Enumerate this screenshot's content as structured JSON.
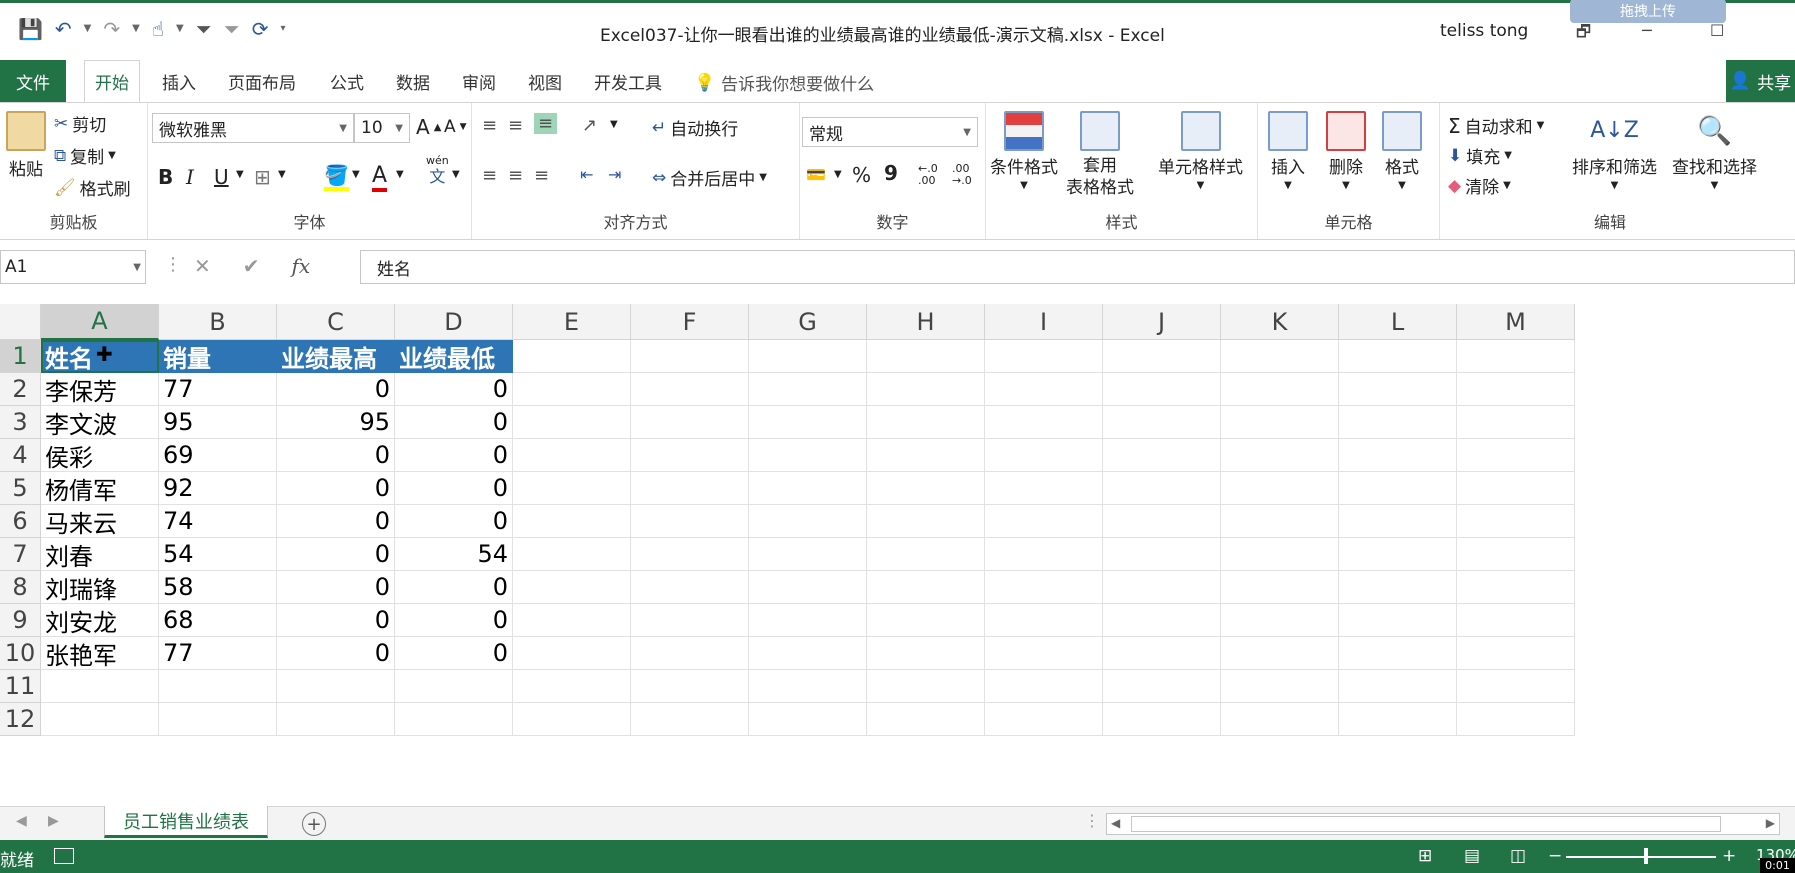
{
  "titlebar": {
    "doc_title": "Excel037-让你一眼看出谁的业绩最高谁的业绩最低-演示文稿.xlsx  -  Excel",
    "user": "teliss tong",
    "upload_label": "拖拽上传",
    "window_buttons": [
      "🗗",
      "─",
      "☐"
    ]
  },
  "tabs": {
    "file": "文件",
    "items": [
      "开始",
      "插入",
      "页面布局",
      "公式",
      "数据",
      "审阅",
      "视图",
      "开发工具"
    ],
    "active": "开始",
    "tellme": "告诉我你想要做什么",
    "share": "共享"
  },
  "ribbon": {
    "clipboard": {
      "label": "剪贴板",
      "paste": "粘贴",
      "cut": "剪切",
      "copy": "复制",
      "format_painter": "格式刷"
    },
    "font": {
      "label": "字体",
      "font_name": "微软雅黑",
      "font_size": "10",
      "bold": "B",
      "italic": "I",
      "underline": "U",
      "phonetic_top": "wén",
      "phonetic_bottom": "文"
    },
    "alignment": {
      "label": "对齐方式",
      "wrap": "自动换行",
      "merge": "合并后居中"
    },
    "number": {
      "label": "数字",
      "format": "常规",
      "percent": "%",
      "comma": "9",
      "increase_decimal": "←.0 .00",
      "decrease_decimal": ".00 →.0"
    },
    "styles": {
      "label": "样式",
      "conditional": "条件格式",
      "table_top": "套用",
      "table_bottom": "表格格式",
      "cell_styles": "单元格样式"
    },
    "cells": {
      "label": "单元格",
      "insert": "插入",
      "delete": "删除",
      "format": "格式"
    },
    "editing": {
      "label": "编辑",
      "autosum": "自动求和",
      "fill": "填充",
      "clear": "清除",
      "sort": "排序和筛选",
      "find": "查找和选择"
    }
  },
  "formula_bar": {
    "name_box": "A1",
    "cancel": "✕",
    "enter": "✔",
    "fx": "fx",
    "content": "姓名"
  },
  "grid": {
    "columns": [
      "A",
      "B",
      "C",
      "D",
      "E",
      "F",
      "G",
      "H",
      "I",
      "J",
      "K",
      "L",
      "M"
    ],
    "row_numbers": [
      "1",
      "2",
      "3",
      "4",
      "5",
      "6",
      "7",
      "8",
      "9",
      "10",
      "11",
      "12"
    ],
    "header": [
      "姓名",
      "销量",
      "业绩最高",
      "业绩最低"
    ],
    "rows": [
      [
        "李保芳",
        "77",
        "0",
        "0"
      ],
      [
        "李文波",
        "95",
        "95",
        "0"
      ],
      [
        "侯彩",
        "69",
        "0",
        "0"
      ],
      [
        "杨倩军",
        "92",
        "0",
        "0"
      ],
      [
        "马来云",
        "74",
        "0",
        "0"
      ],
      [
        "刘春",
        "54",
        "0",
        "54"
      ],
      [
        "刘瑞锋",
        "58",
        "0",
        "0"
      ],
      [
        "刘安龙",
        "68",
        "0",
        "0"
      ],
      [
        "张艳军",
        "77",
        "0",
        "0"
      ]
    ]
  },
  "sheets": {
    "active": "员工销售业绩表"
  },
  "status": {
    "text": "就绪",
    "zoom": "130%",
    "timer": "0:01"
  },
  "colors": {
    "accent": "#217346",
    "header_fill": "#2e75b6"
  }
}
